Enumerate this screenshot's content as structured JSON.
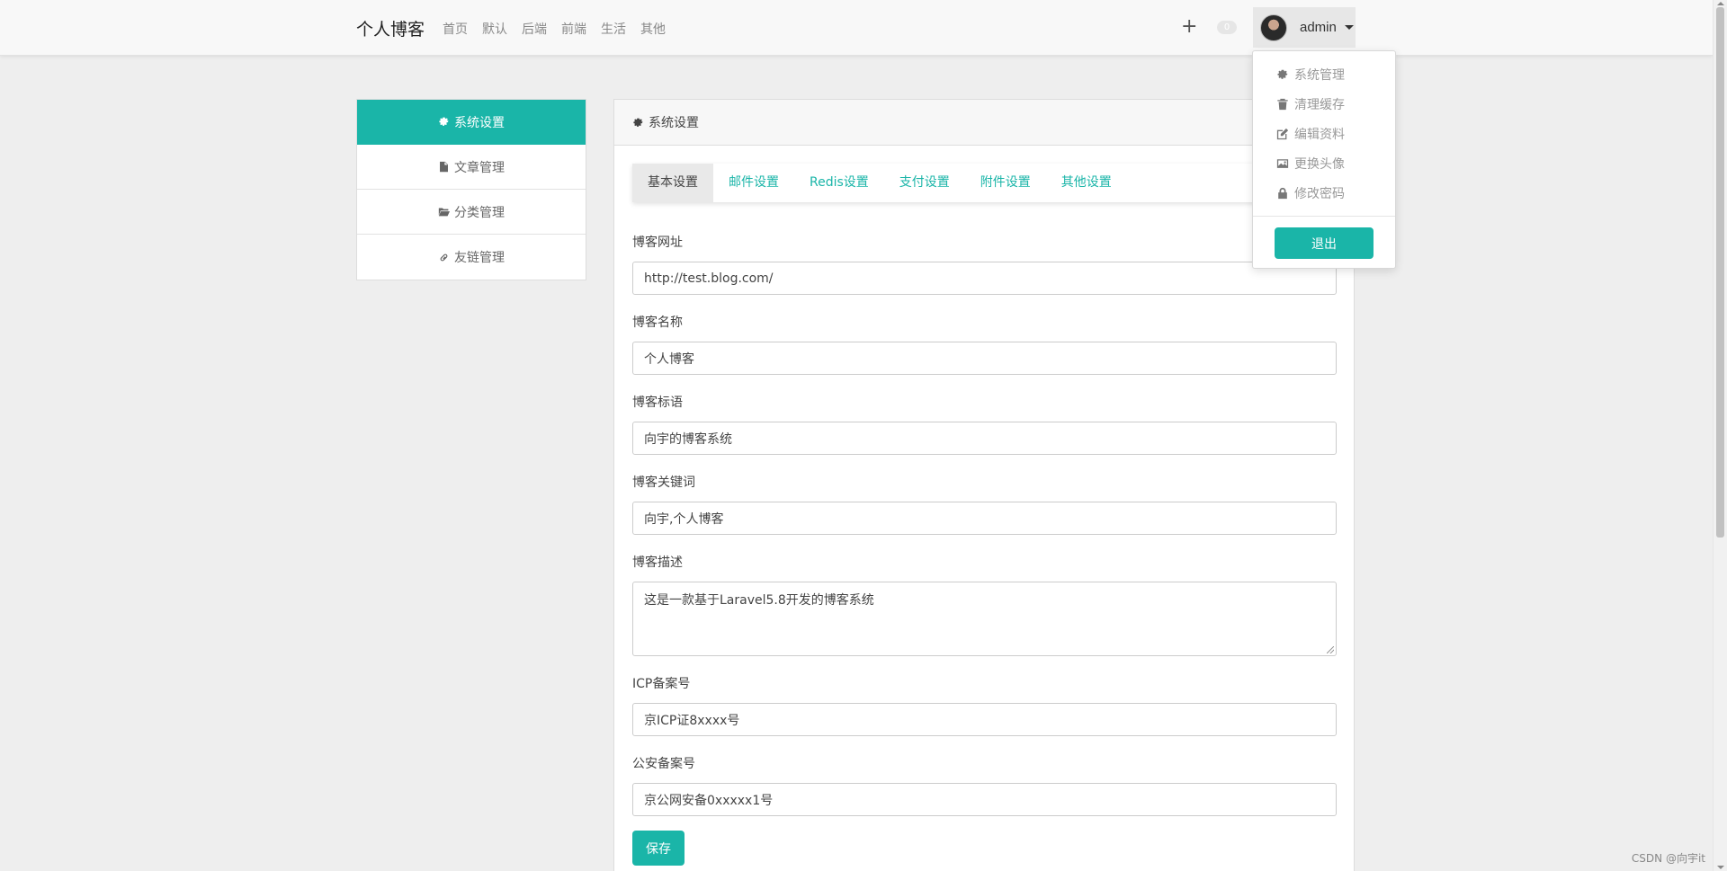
{
  "navbar": {
    "brand": "个人博客",
    "links": [
      "首页",
      "默认",
      "后端",
      "前端",
      "生活",
      "其他"
    ],
    "plus_label": "+",
    "badge_count": "0",
    "user_name": "admin"
  },
  "user_menu": {
    "items": [
      {
        "label": "系统管理",
        "icon": "gear-icon"
      },
      {
        "label": "清理缓存",
        "icon": "trash-icon"
      },
      {
        "label": "编辑资料",
        "icon": "edit-icon"
      },
      {
        "label": "更换头像",
        "icon": "image-icon"
      },
      {
        "label": "修改密码",
        "icon": "lock-icon"
      }
    ],
    "logout_label": "退出"
  },
  "sidebar": {
    "items": [
      {
        "label": "系统设置",
        "icon": "gear-icon",
        "active": true
      },
      {
        "label": "文章管理",
        "icon": "file-icon",
        "active": false
      },
      {
        "label": "分类管理",
        "icon": "folder-icon",
        "active": false
      },
      {
        "label": "友链管理",
        "icon": "link-icon",
        "active": false
      }
    ]
  },
  "panel": {
    "title": "系统设置",
    "tabs": [
      "基本设置",
      "邮件设置",
      "Redis设置",
      "支付设置",
      "附件设置",
      "其他设置"
    ],
    "active_tab": "基本设置"
  },
  "form": {
    "blog_url": {
      "label": "博客网址",
      "value": "http://test.blog.com/"
    },
    "blog_name": {
      "label": "博客名称",
      "value": "个人博客"
    },
    "blog_slogan": {
      "label": "博客标语",
      "value": "向宇的博客系统"
    },
    "blog_keywords": {
      "label": "博客关键词",
      "value": "向宇,个人博客"
    },
    "blog_description": {
      "label": "博客描述",
      "value": "这是一款基于Laravel5.8开发的博客系统"
    },
    "icp": {
      "label": "ICP备案号",
      "value": "京ICP证8xxxx号"
    },
    "police": {
      "label": "公安备案号",
      "value": "京公网安备0xxxxx1号"
    },
    "save_label": "保存"
  },
  "watermark": "CSDN @向宇it",
  "colors": {
    "accent": "#1ab5a8",
    "navbar_bg": "#f8f8f8",
    "page_bg": "#eeeeee"
  }
}
